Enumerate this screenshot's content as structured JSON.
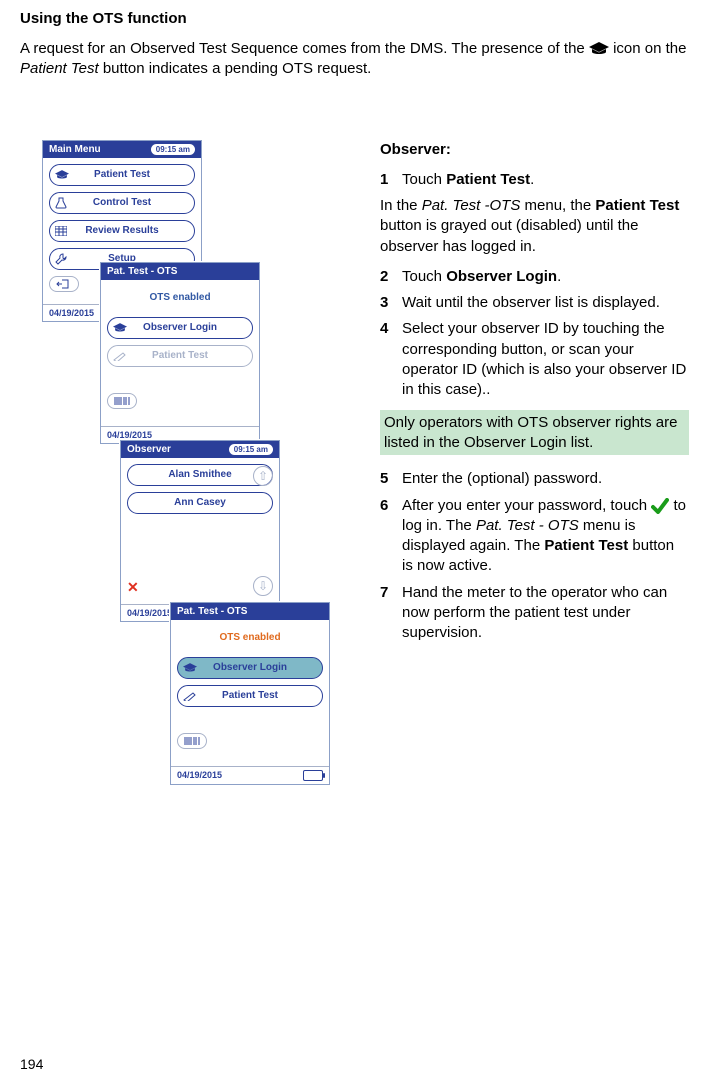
{
  "heading": "Using the OTS function",
  "intro_before_icon": "A request for an Observed Test Sequence comes from the DMS. The presence of the ",
  "intro_after_icon": " icon on the ",
  "intro_button_name": "Patient Test",
  "intro_end": " button indicates a pending OTS request.",
  "observer_title": "Observer:",
  "steps": {
    "s1": "Touch ",
    "s1_bold": "Patient Test",
    "s1_end": ".",
    "after_s1_line1": "In the ",
    "after_s1_italic1": "Pat. Test -OTS",
    "after_s1_mid": " menu, the ",
    "after_s1_bold": "Patient Test",
    "after_s1_end": " button is grayed out (disabled) until the observer has logged in.",
    "s2": "Touch ",
    "s2_bold": "Observer Login",
    "s2_end": ".",
    "s3": "Wait until the observer list is displayed.",
    "s4": "Select your observer ID by touching the corresponding button, or scan your operator ID (which is also your observer ID in this case)..",
    "note": "Only operators with OTS observer rights are listed in the Observer Login list.",
    "s5": "Enter the (optional) password.",
    "s6_a": "After you enter your password, touch ",
    "s6_b": " to log in. The ",
    "s6_italic": "Pat. Test - OTS",
    "s6_c": " menu is displayed again. The ",
    "s6_bold": "Patient Test",
    "s6_d": " button is now active.",
    "s7": "Hand the meter to the operator who can now perform the patient test under supervision."
  },
  "screen1": {
    "title": "Main Menu",
    "time": "09:15 am",
    "items": [
      "Patient Test",
      "Control Test",
      "Review Results",
      "Setup"
    ],
    "date": "04/19/2015"
  },
  "screen2": {
    "title": "Pat. Test - OTS",
    "ots": "OTS enabled",
    "observer_login": "Observer Login",
    "patient_test": "Patient Test",
    "date": "04/19/2015"
  },
  "screen3": {
    "title": "Observer",
    "time": "09:15 am",
    "items": [
      "Alan Smithee",
      "Ann Casey"
    ],
    "date": "04/19/2015"
  },
  "screen4": {
    "title": "Pat. Test - OTS",
    "ots": "OTS enabled",
    "observer_login": "Observer Login",
    "patient_test": "Patient Test",
    "date": "04/19/2015"
  },
  "page_number": "194"
}
